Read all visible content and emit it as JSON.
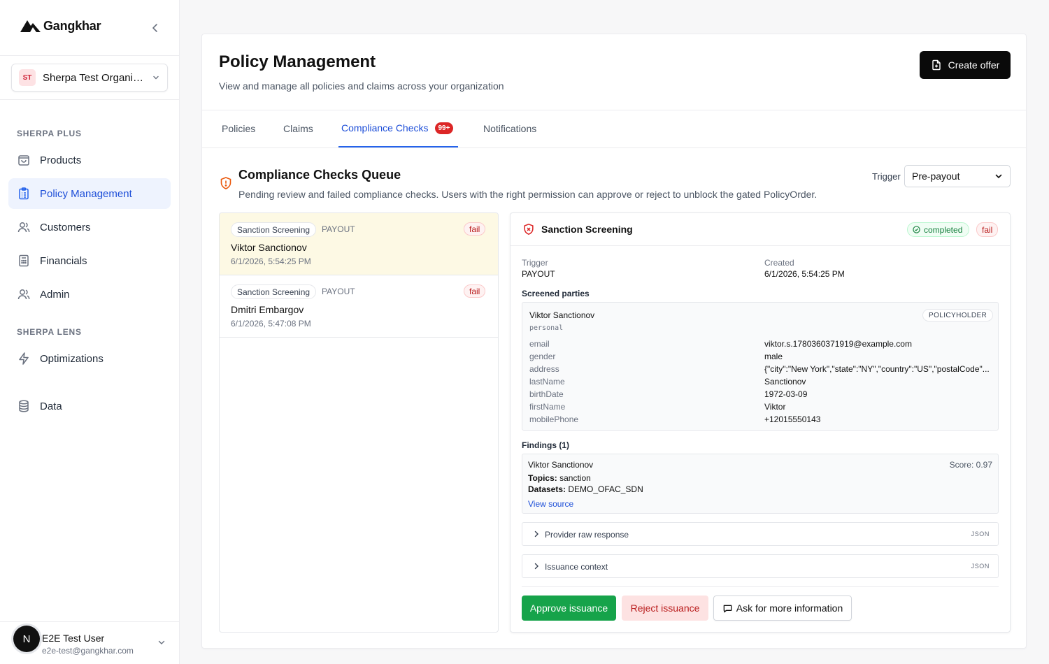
{
  "app": {
    "name": "Gangkhar"
  },
  "org": {
    "initials": "ST",
    "name": "Sherpa Test Organization"
  },
  "sidebar": {
    "sections": [
      {
        "title": "SHERPA PLUS"
      },
      {
        "title": "SHERPA LENS"
      }
    ],
    "items": [
      {
        "label": "Products",
        "icon": "shopping-bag-icon"
      },
      {
        "label": "Policy Management",
        "icon": "clipboard-list-icon",
        "active": true
      },
      {
        "label": "Customers",
        "icon": "users-icon"
      },
      {
        "label": "Financials",
        "icon": "calculator-icon"
      },
      {
        "label": "Admin",
        "icon": "users-icon"
      },
      {
        "label": "Optimizations",
        "icon": "lightning-icon"
      },
      {
        "label": "Data",
        "icon": "database-icon"
      }
    ]
  },
  "user": {
    "initial": "N",
    "name": "E2E Test User",
    "email": "e2e-test@gangkhar.com"
  },
  "header": {
    "title": "Policy Management",
    "subtitle": "View and manage all policies and claims across your organization",
    "create_label": "Create offer"
  },
  "tabs": [
    {
      "label": "Policies"
    },
    {
      "label": "Claims"
    },
    {
      "label": "Compliance Checks",
      "badge": "99+",
      "active": true
    },
    {
      "label": "Notifications"
    }
  ],
  "queue": {
    "title": "Compliance Checks Queue",
    "subtitle": "Pending review and failed compliance checks. Users with the right permission can approve or reject to unblock the gated PolicyOrder.",
    "trigger_label": "Trigger",
    "trigger_value": "Pre-payout",
    "items": [
      {
        "type": "Sanction Screening",
        "kind": "PAYOUT",
        "status": "fail",
        "name": "Viktor Sanctionov",
        "date": "6/1/2026, 5:54:25 PM",
        "selected": true
      },
      {
        "type": "Sanction Screening",
        "kind": "PAYOUT",
        "status": "fail",
        "name": "Dmitri Embargov",
        "date": "6/1/2026, 5:47:08 PM",
        "selected": false
      }
    ]
  },
  "detail": {
    "title": "Sanction Screening",
    "status_completed": "completed",
    "status_result": "fail",
    "trigger_label": "Trigger",
    "trigger_value": "PAYOUT",
    "created_label": "Created",
    "created_value": "6/1/2026, 5:54:25 PM",
    "parties_label": "Screened parties",
    "party": {
      "name": "Viktor Sanctionov",
      "type": "personal",
      "role": "POLICYHOLDER",
      "attributes": [
        {
          "key": "email",
          "value": "viktor.s.1780360371919@example.com"
        },
        {
          "key": "gender",
          "value": "male"
        },
        {
          "key": "address",
          "value": "{\"city\":\"New York\",\"state\":\"NY\",\"country\":\"US\",\"postalCode\"..."
        },
        {
          "key": "lastName",
          "value": "Sanctionov"
        },
        {
          "key": "birthDate",
          "value": "1972-03-09"
        },
        {
          "key": "firstName",
          "value": "Viktor"
        },
        {
          "key": "mobilePhone",
          "value": "+12015550143"
        }
      ]
    },
    "findings_label": "Findings (1)",
    "finding": {
      "name": "Viktor Sanctionov",
      "score": "Score: 0.97",
      "topics_label": "Topics:",
      "topics": "sanction",
      "datasets_label": "Datasets:",
      "datasets": "DEMO_OFAC_SDN",
      "link": "View source"
    },
    "collapsibles": [
      {
        "label": "Provider raw response",
        "tag": "JSON"
      },
      {
        "label": "Issuance context",
        "tag": "JSON"
      }
    ],
    "actions": {
      "approve": "Approve issuance",
      "reject": "Reject issuance",
      "ask": "Ask for more information"
    }
  },
  "colors": {
    "accent": "#2563eb",
    "approve": "#16a34a",
    "fail": "#b91c1c",
    "selected_row": "#fdf9e4"
  }
}
